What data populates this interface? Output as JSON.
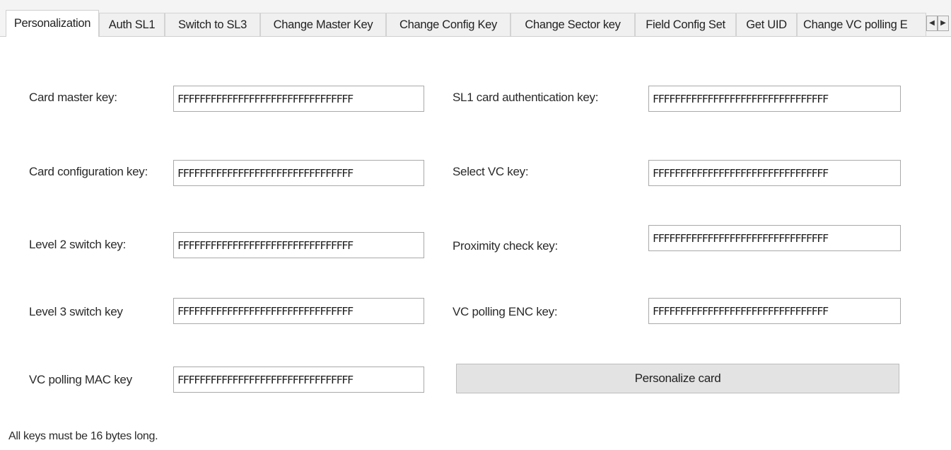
{
  "tabs": {
    "items": [
      {
        "label": "Personalization",
        "active": true
      },
      {
        "label": "Auth SL1"
      },
      {
        "label": "Switch to SL3"
      },
      {
        "label": "Change Master Key"
      },
      {
        "label": "Change Config Key"
      },
      {
        "label": "Change Sector key"
      },
      {
        "label": "Field Config Set"
      },
      {
        "label": "Get UID"
      },
      {
        "label": "Change VC polling E"
      }
    ],
    "scroll_left": "◀",
    "scroll_right": "▶"
  },
  "form": {
    "card_master_key": {
      "label": "Card master key:",
      "value": "FFFFFFFFFFFFFFFFFFFFFFFFFFFFFFFF"
    },
    "card_configuration_key": {
      "label": "Card configuration key:",
      "value": "FFFFFFFFFFFFFFFFFFFFFFFFFFFFFFFF"
    },
    "level2_switch_key": {
      "label": "Level 2 switch key:",
      "value": "FFFFFFFFFFFFFFFFFFFFFFFFFFFFFFFF"
    },
    "level3_switch_key": {
      "label": "Level 3 switch key",
      "value": "FFFFFFFFFFFFFFFFFFFFFFFFFFFFFFFF"
    },
    "vc_polling_mac_key": {
      "label": "VC polling MAC key",
      "value": "FFFFFFFFFFFFFFFFFFFFFFFFFFFFFFFF"
    },
    "sl1_card_auth_key": {
      "label": "SL1 card authentication key:",
      "value": "FFFFFFFFFFFFFFFFFFFFFFFFFFFFFFFF"
    },
    "select_vc_key": {
      "label": "Select VC key:",
      "value": "FFFFFFFFFFFFFFFFFFFFFFFFFFFFFFFF"
    },
    "proximity_check_key": {
      "label": "Proximity check key:",
      "value": "FFFFFFFFFFFFFFFFFFFFFFFFFFFFFFFF"
    },
    "vc_polling_enc_key": {
      "label": "VC polling ENC key:",
      "value": "FFFFFFFFFFFFFFFFFFFFFFFFFFFFFFFF"
    }
  },
  "personalize_button": "Personalize card",
  "note": "All keys must be 16 bytes long."
}
